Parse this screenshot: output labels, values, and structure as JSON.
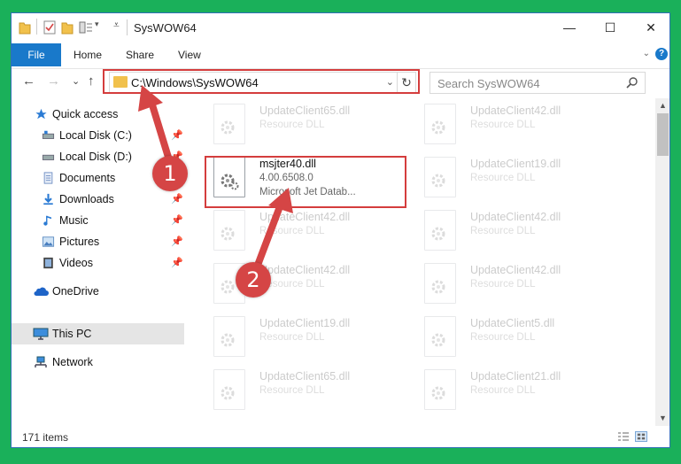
{
  "window": {
    "title": "SysWOW64",
    "minimize": "—",
    "maximize": "☐",
    "close": "✕"
  },
  "ribbon": {
    "file": "File",
    "home": "Home",
    "share": "Share",
    "view": "View",
    "expand": "⌄",
    "help": "?"
  },
  "nav": {
    "back": "←",
    "forward": "→",
    "recent": "⌄",
    "up": "↑"
  },
  "address": {
    "path": "C:\\Windows\\SysWOW64",
    "dropdown": "⌄",
    "refresh": "↻"
  },
  "search": {
    "placeholder": "Search SysWOW64"
  },
  "sidebar": {
    "items": [
      {
        "label": "Quick access"
      },
      {
        "label": "Local Disk (C:)"
      },
      {
        "label": "Local Disk (D:)"
      },
      {
        "label": "Documents"
      },
      {
        "label": "Downloads"
      },
      {
        "label": "Music"
      },
      {
        "label": "Pictures"
      },
      {
        "label": "Videos"
      },
      {
        "label": "OneDrive"
      },
      {
        "label": "This PC"
      },
      {
        "label": "Network"
      }
    ]
  },
  "files": [
    {
      "name": "UpdateClient65.dll",
      "type": "Resource DLL"
    },
    {
      "name": "UpdateClient42.dll",
      "type": "Resource DLL"
    },
    {
      "name": "msjter40.dll",
      "version": "4.00.6508.0",
      "description": "Microsoft Jet Datab..."
    },
    {
      "name": "UpdateClient19.dll",
      "type": "Resource DLL"
    },
    {
      "name": "UpdateClient42.dll",
      "type": "Resource DLL"
    },
    {
      "name": "UpdateClient42.dll",
      "type": "Resource DLL"
    },
    {
      "name": "UpdateClient42.dll",
      "type": "Resource DLL"
    },
    {
      "name": "UpdateClient42.dll",
      "type": "Resource DLL"
    },
    {
      "name": "UpdateClient19.dll",
      "type": "Resource DLL"
    },
    {
      "name": "UpdateClient5.dll",
      "type": "Resource DLL"
    },
    {
      "name": "UpdateClient65.dll",
      "type": "Resource DLL"
    },
    {
      "name": "UpdateClient21.dll",
      "type": "Resource DLL"
    }
  ],
  "status": {
    "count": "171 items"
  },
  "annotations": {
    "step1": "1",
    "step2": "2"
  },
  "colors": {
    "accent": "#1979ca",
    "annotation": "#d43d3d",
    "background": "#1ab05a"
  }
}
